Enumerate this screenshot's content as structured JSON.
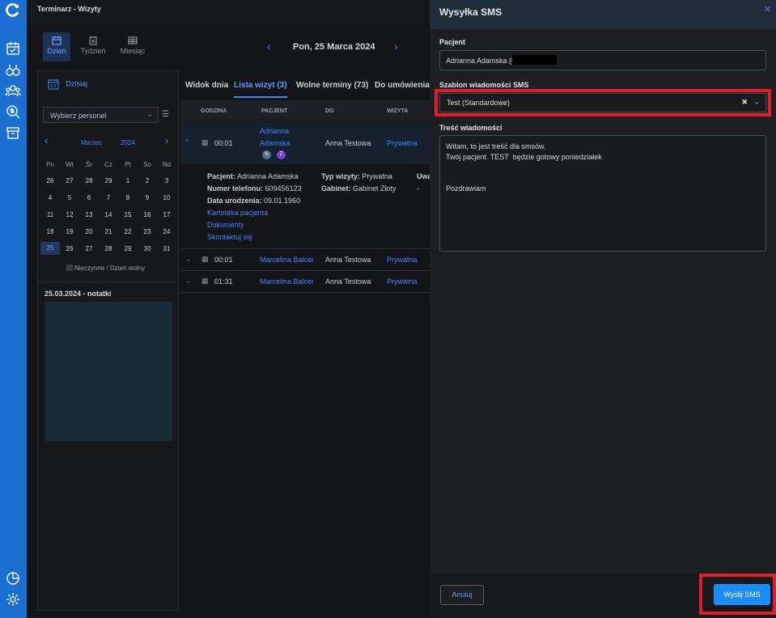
{
  "app_title": "Terminarz - Wizyty",
  "views": [
    {
      "label": "Dzień",
      "icon": "calendar-day-icon"
    },
    {
      "label": "Tydzień",
      "icon": "calendar-week-icon"
    },
    {
      "label": "Miesiąc",
      "icon": "calendar-month-icon"
    }
  ],
  "date_title": "Pon, 25 Marca 2024",
  "left": {
    "today_label": "Dzisiaj",
    "personnel_placeholder": "Wybierz personel",
    "calendar": {
      "month": "Marzec",
      "year": "2024",
      "weekdays": [
        "Pn",
        "Wt",
        "Śr",
        "Cz",
        "Pt",
        "So",
        "Nd"
      ],
      "weeks": [
        [
          "26",
          "27",
          "28",
          "29",
          "1",
          "2",
          "3"
        ],
        [
          "4",
          "5",
          "6",
          "7",
          "8",
          "9",
          "10"
        ],
        [
          "11",
          "12",
          "13",
          "14",
          "15",
          "16",
          "17"
        ],
        [
          "18",
          "19",
          "20",
          "21",
          "22",
          "23",
          "24"
        ],
        [
          "25",
          "26",
          "27",
          "28",
          "29",
          "30",
          "31"
        ]
      ],
      "legend": "Nieczynne / Dzień wolny"
    },
    "notes_title": "25.03.2024 - notatki"
  },
  "main": {
    "tabs": [
      "Widok dnia",
      "Lista wizyt (3)",
      "Wolne terminy (73)",
      "Do umówienia ("
    ],
    "columns": [
      "GODZINA",
      "PACJENT",
      "DO",
      "WIZYTA"
    ],
    "rows": [
      {
        "time": "00:01",
        "patient_first": "Adrianna",
        "patient_last": "Adamska",
        "doctor": "Anna Testowa",
        "visit": "Prywatna",
        "badges": [
          "N",
          "Z"
        ]
      },
      {
        "time": "00:01",
        "patient": "Marcelina Balcer",
        "doctor": "Anna Testowa",
        "visit": "Prywatna"
      },
      {
        "time": "01:31",
        "patient": "Marcelina Balcer",
        "doctor": "Anna Testowa",
        "visit": "Prywatna"
      }
    ],
    "details": {
      "patient_label": "Pacjent:",
      "patient_value": "Adrianna Adamska",
      "phone_label": "Numer telefonu:",
      "phone_value": "609456123",
      "birth_label": "Data urodzenia:",
      "birth_value": "09.01.1960",
      "type_label": "Typ wizyty:",
      "type_value": "Prywatna",
      "office_label": "Gabinet:",
      "office_value": "Gabinet Złoty",
      "notes_col": "Uwa",
      "notes_val": "-",
      "links": [
        "Kartoteka pacjenta",
        "Dokumenty",
        "Skontaktuj się"
      ]
    }
  },
  "modal": {
    "title": "Wysyłka SMS",
    "patient_label": "Pacjent",
    "patient_value": "Adrianna Adamska (6",
    "template_label": "Szablon wiadomości SMS",
    "template_value": "Test (Standardowe)",
    "message_label": "Treść wiadomości",
    "message_value": "Witam, to jest treść dla smsów.\nTwój pacjent  TEST  będzie gotowy poniedziałek\n\n\nPozdrawiam",
    "cancel_label": "Anuluj",
    "send_label": "Wyślij SMS"
  },
  "colors": {
    "accent": "#1a8cff",
    "highlight": "#e11d2a",
    "rail": "#1a6fd0"
  }
}
